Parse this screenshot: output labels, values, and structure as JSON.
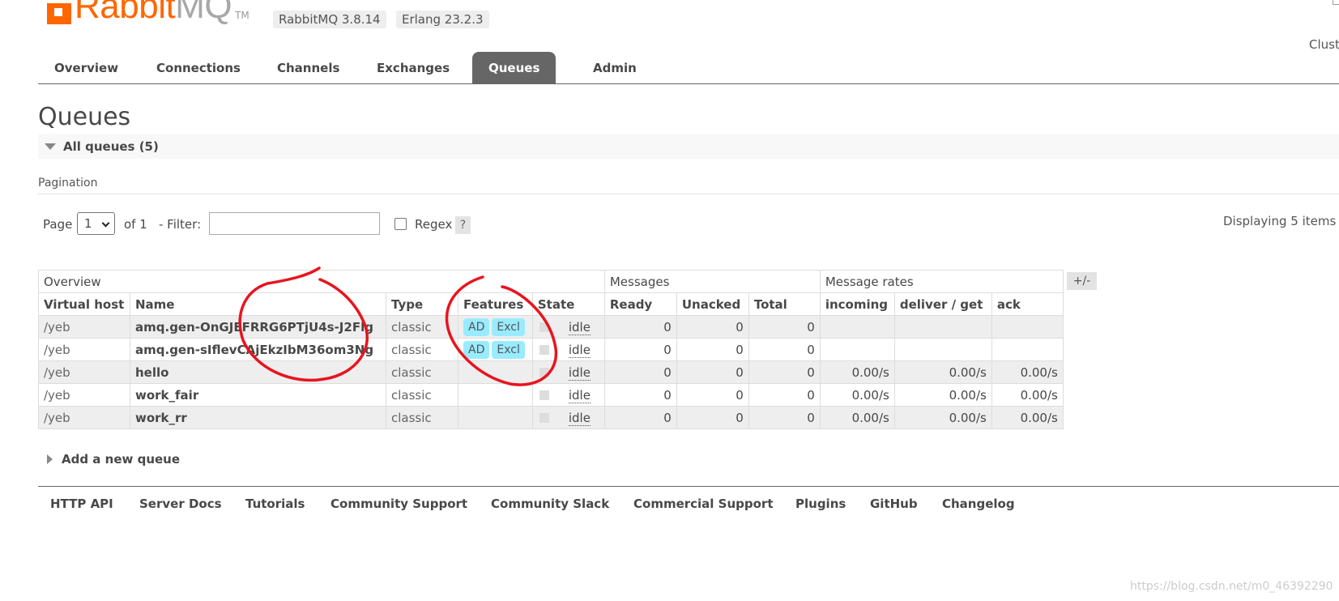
{
  "header": {
    "logo_text": "RabbitMQ",
    "logo_primary": "Rabbit",
    "logo_secondary": "MQ",
    "logo_tm": "TM",
    "version": "RabbitMQ 3.8.14",
    "erlang": "Erlang 23.2.3",
    "cluster_text": "Clust"
  },
  "tabs": [
    {
      "label": "Overview"
    },
    {
      "label": "Connections"
    },
    {
      "label": "Channels"
    },
    {
      "label": "Exchanges"
    },
    {
      "label": "Queues",
      "active": true
    },
    {
      "label": "Admin"
    }
  ],
  "page": {
    "title": "Queues",
    "section_label": "All queues (5)",
    "pagination_label": "Pagination",
    "page_label": "Page",
    "page_selected": "1",
    "of_label": "of 1",
    "filter_label": "- Filter:",
    "filter_value": "",
    "regex_label": "Regex",
    "help_label": "?",
    "displaying": "Displaying 5 items",
    "plus_minus": "+/-",
    "add_queue": "Add a new queue"
  },
  "table": {
    "groups": [
      "Overview",
      "Messages",
      "Message rates"
    ],
    "columns": [
      "Virtual host",
      "Name",
      "Type",
      "Features",
      "State",
      "Ready",
      "Unacked",
      "Total",
      "incoming",
      "deliver / get",
      "ack"
    ],
    "rows": [
      {
        "vhost": "/yeb",
        "name": "amq.gen-OnGJEFRRG6PTjU4s-J2Flg",
        "type": "classic",
        "features": [
          "AD",
          "Excl"
        ],
        "state": "idle",
        "ready": "0",
        "unacked": "0",
        "total": "0",
        "incoming": "",
        "deliver": "",
        "ack": ""
      },
      {
        "vhost": "/yeb",
        "name": "amq.gen-sIflevCAjEkzIbM36om3Ng",
        "type": "classic",
        "features": [
          "AD",
          "Excl"
        ],
        "state": "idle",
        "ready": "0",
        "unacked": "0",
        "total": "0",
        "incoming": "",
        "deliver": "",
        "ack": ""
      },
      {
        "vhost": "/yeb",
        "name": "hello",
        "type": "classic",
        "features": [],
        "state": "idle",
        "ready": "0",
        "unacked": "0",
        "total": "0",
        "incoming": "0.00/s",
        "deliver": "0.00/s",
        "ack": "0.00/s"
      },
      {
        "vhost": "/yeb",
        "name": "work_fair",
        "type": "classic",
        "features": [],
        "state": "idle",
        "ready": "0",
        "unacked": "0",
        "total": "0",
        "incoming": "0.00/s",
        "deliver": "0.00/s",
        "ack": "0.00/s"
      },
      {
        "vhost": "/yeb",
        "name": "work_rr",
        "type": "classic",
        "features": [],
        "state": "idle",
        "ready": "0",
        "unacked": "0",
        "total": "0",
        "incoming": "0.00/s",
        "deliver": "0.00/s",
        "ack": "0.00/s"
      }
    ]
  },
  "footer": [
    "HTTP API",
    "Server Docs",
    "Tutorials",
    "Community Support",
    "Community Slack",
    "Commercial Support",
    "Plugins",
    "GitHub",
    "Changelog"
  ],
  "watermark": "https://blog.csdn.net/m0_46392290",
  "colors": {
    "brand_orange": "#ff6600",
    "tab_active_bg": "#666666",
    "feature_badge": "#99ebff",
    "annotation_red": "#e8141e"
  }
}
